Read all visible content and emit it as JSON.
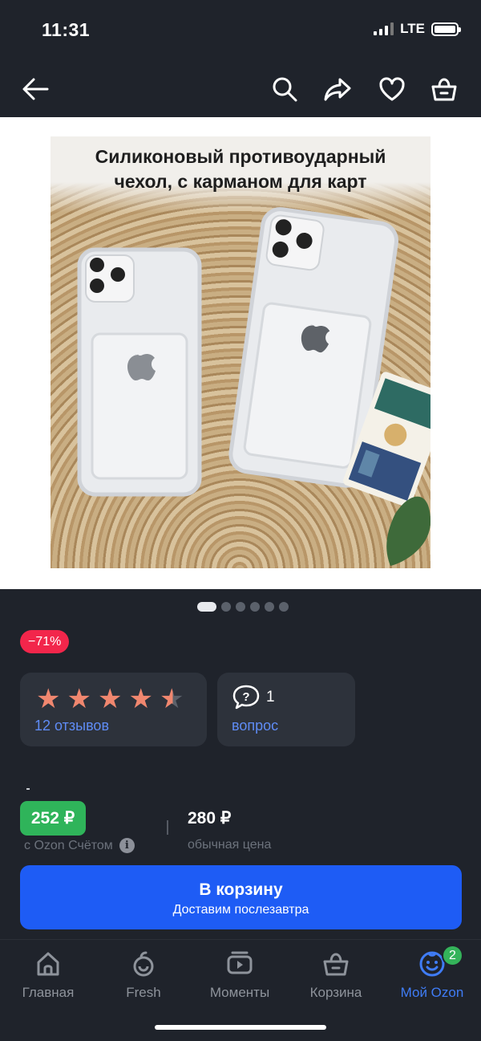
{
  "status": {
    "time": "11:31",
    "network": "LTE"
  },
  "topbar": {
    "icons": [
      "back-arrow-icon",
      "search-icon",
      "share-icon",
      "heart-icon",
      "basket-icon"
    ]
  },
  "product": {
    "image_caption_line1": "Силиконовый противоударный",
    "image_caption_line2": "чехол, с карманом для карт",
    "gallery_count": 6,
    "gallery_active_index": 0
  },
  "discount": {
    "label": "−71%"
  },
  "rating": {
    "stars": 4.5,
    "reviews_label": "12 отзывов"
  },
  "questions": {
    "count": "1",
    "label": "вопрос"
  },
  "price": {
    "ozon_price": "252 ₽",
    "ozon_note": "с Ozon Счётом",
    "regular_price": "280 ₽",
    "regular_label": "обычная цена"
  },
  "cart_button": {
    "label": "В корзину",
    "sublabel": "Доставим послезавтра"
  },
  "tabbar": {
    "items": [
      {
        "label": "Главная",
        "icon": "home-icon"
      },
      {
        "label": "Fresh",
        "icon": "fresh-icon"
      },
      {
        "label": "Моменты",
        "icon": "moments-icon"
      },
      {
        "label": "Корзина",
        "icon": "basket-icon"
      },
      {
        "label": "Мой Ozon",
        "icon": "profile-icon",
        "badge": "2"
      }
    ]
  },
  "colors": {
    "accent": "#1e5cf5",
    "green": "#2fb45a",
    "discount": "#f2264b",
    "link": "#5f8cf5",
    "star": "#f0876f"
  }
}
